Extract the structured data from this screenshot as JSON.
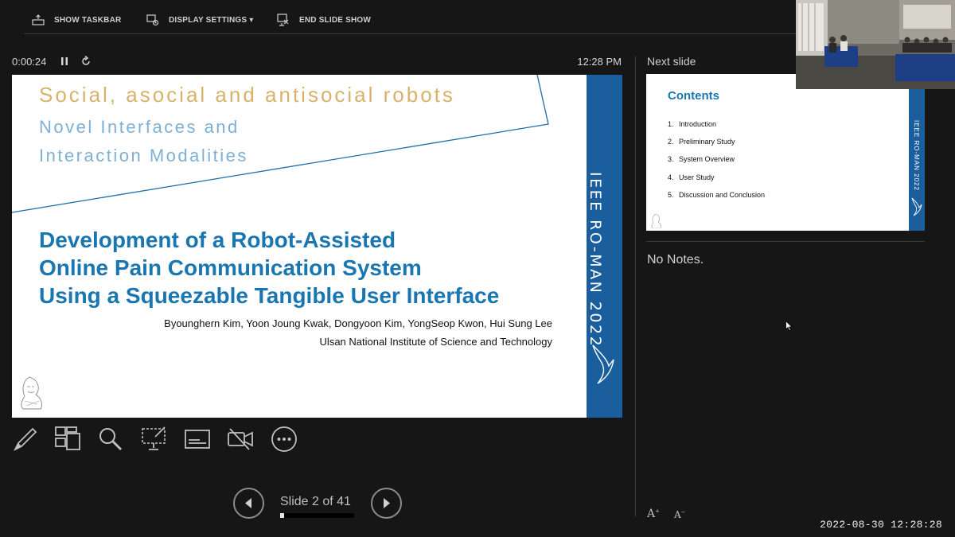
{
  "toolbar": {
    "show_taskbar": "SHOW TASKBAR",
    "display_settings": "DISPLAY SETTINGS ▾",
    "end_slide_show": "END SLIDE SHOW"
  },
  "timer": {
    "elapsed": "0:00:24",
    "clock": "12:28 PM"
  },
  "current_slide": {
    "title_line1": "Social, asocial and antisocial robots",
    "title_line2": "Novel Interfaces and",
    "title_line3": "Interaction Modalities",
    "main_line1": "Development of a Robot-Assisted",
    "main_line2": "Online Pain Communication System",
    "main_line3": "Using a Squeezable Tangible User Interface",
    "authors": "Byounghern Kim, Yoon Joung Kwak, Dongyoon Kim, YongSeop Kwon, Hui Sung Lee",
    "institution": "Ulsan National Institute of Science and Technology",
    "band_text": "IEEE RO-MAN 2022",
    "band_color": "#1b5e9e",
    "title_color": "#1a76b0"
  },
  "navigation": {
    "slide_count": "Slide 2 of 41",
    "progress_fraction": 0.05
  },
  "next_slide": {
    "label": "Next slide",
    "title": "Contents",
    "items": [
      {
        "num": "1.",
        "text": "Introduction"
      },
      {
        "num": "2.",
        "text": "Preliminary Study"
      },
      {
        "num": "3.",
        "text": "System Overview"
      },
      {
        "num": "4.",
        "text": "User Study"
      },
      {
        "num": "5.",
        "text": "Discussion and Conclusion"
      }
    ],
    "band_text": "IEEE RO-MAN 2022"
  },
  "notes": {
    "text": "No Notes."
  },
  "tools": [
    "pen-icon",
    "grid-icon",
    "zoom-icon",
    "pointer-screen-icon",
    "subtitles-icon",
    "camera-off-icon",
    "more-icon"
  ],
  "timestamp": "2022-08-30 12:28:28"
}
